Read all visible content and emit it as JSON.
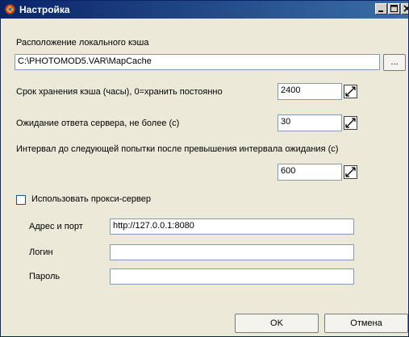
{
  "window": {
    "title": "Настройка"
  },
  "cache": {
    "location_label": "Расположение локального кэша",
    "location_value": "C:\\PHOTOMOD5.VAR\\MapCache",
    "browse_label": "...",
    "lifetime_label": "Срок хранения кэша (часы), 0=хранить постоянно",
    "lifetime_value": "2400",
    "timeout_label": "Ожидание ответа сервера, не более (с)",
    "timeout_value": "30",
    "retry_label": "Интервал до следующей попытки после превышения интервала ожидания (с)",
    "retry_value": "600"
  },
  "proxy": {
    "use_label": "Использовать прокси-сервер",
    "use_checked": false,
    "address_label": "Адрес и порт",
    "address_value": "http://127.0.0.1:8080",
    "login_label": "Логин",
    "login_value": "",
    "password_label": "Пароль",
    "password_value": ""
  },
  "buttons": {
    "ok": "OK",
    "cancel": "Отмена"
  }
}
